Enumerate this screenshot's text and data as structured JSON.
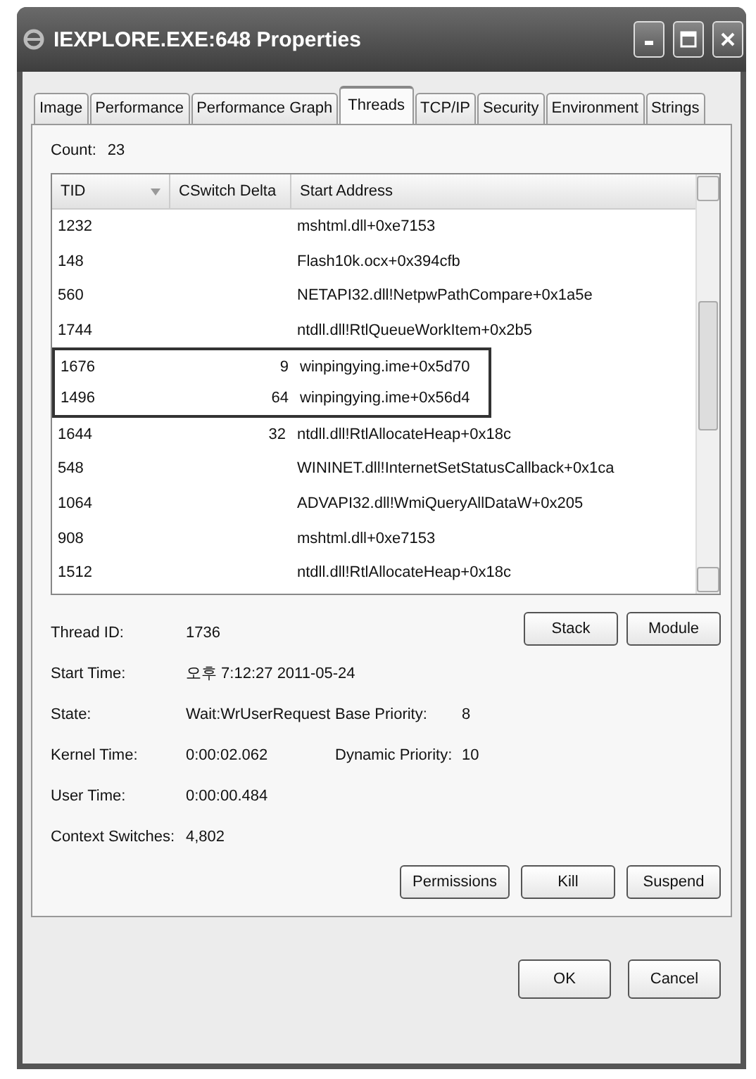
{
  "window": {
    "title": "IEXPLORE.EXE:648 Properties"
  },
  "tabs": [
    {
      "label": "Image",
      "selected": false
    },
    {
      "label": "Performance",
      "selected": false
    },
    {
      "label": "Performance Graph",
      "selected": false
    },
    {
      "label": "Threads",
      "selected": true
    },
    {
      "label": "TCP/IP",
      "selected": false
    },
    {
      "label": "Security",
      "selected": false
    },
    {
      "label": "Environment",
      "selected": false
    },
    {
      "label": "Strings",
      "selected": false
    }
  ],
  "count": {
    "label": "Count:",
    "value": "23"
  },
  "table": {
    "columns": [
      "TID",
      "CSwitch Delta",
      "Start Address"
    ],
    "rows": [
      {
        "tid": "1232",
        "delta": "",
        "address": "mshtml.dll+0xe7153",
        "outlined": false
      },
      {
        "tid": "148",
        "delta": "",
        "address": "Flash10k.ocx+0x394cfb",
        "outlined": false
      },
      {
        "tid": "560",
        "delta": "",
        "address": "NETAPI32.dll!NetpwPathCompare+0x1a5e",
        "outlined": false
      },
      {
        "tid": "1744",
        "delta": "",
        "address": "ntdll.dll!RtlQueueWorkItem+0x2b5",
        "outlined": false
      },
      {
        "tid": "1676",
        "delta": "9",
        "address": "winpingying.ime+0x5d70",
        "outlined": true
      },
      {
        "tid": "1496",
        "delta": "64",
        "address": "winpingying.ime+0x56d4",
        "outlined": true
      },
      {
        "tid": "1644",
        "delta": "32",
        "address": "ntdll.dll!RtlAllocateHeap+0x18c",
        "outlined": false
      },
      {
        "tid": "548",
        "delta": "",
        "address": "WININET.dll!InternetSetStatusCallback+0x1ca",
        "outlined": false
      },
      {
        "tid": "1064",
        "delta": "",
        "address": "ADVAPI32.dll!WmiQueryAllDataW+0x205",
        "outlined": false
      },
      {
        "tid": "908",
        "delta": "",
        "address": "mshtml.dll+0xe7153",
        "outlined": false
      },
      {
        "tid": "1512",
        "delta": "",
        "address": "ntdll.dll!RtlAllocateHeap+0x18c",
        "outlined": false
      }
    ]
  },
  "details": [
    {
      "label": "Thread ID:",
      "value": "1736"
    },
    {
      "label": "Start Time:",
      "value": "오후 7:12:27  2011-05-24"
    },
    {
      "label": "State:",
      "value": "Wait:WrUserRequest",
      "extra_label": "Base Priority:",
      "extra_value": "8"
    },
    {
      "label": "Kernel Time:",
      "value": "0:00:02.062",
      "extra_label": "Dynamic Priority:",
      "extra_value": "10"
    },
    {
      "label": "User Time:",
      "value": "0:00:00.484"
    },
    {
      "label": "Context Switches:",
      "value": "4,802"
    }
  ],
  "side_buttons": [
    "Stack",
    "Module"
  ],
  "action_buttons": [
    "Permissions",
    "Kill",
    "Suspend"
  ],
  "dialog_buttons": [
    "OK",
    "Cancel"
  ]
}
